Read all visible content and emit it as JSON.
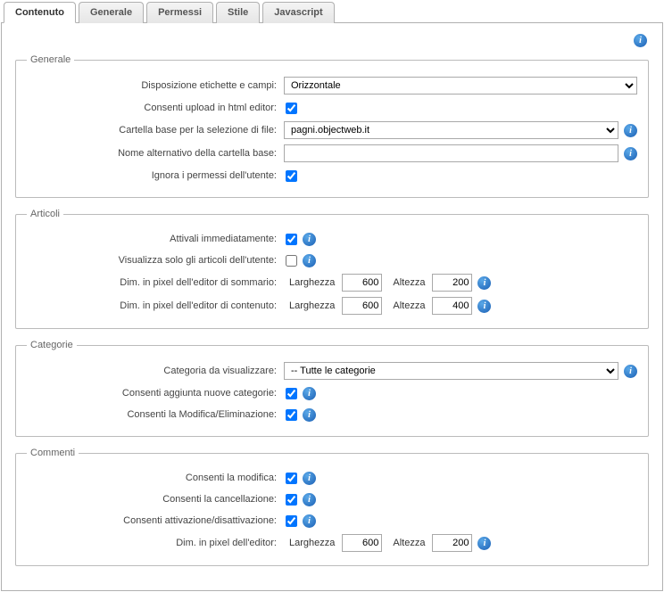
{
  "tabs": {
    "contenuto": "Contenuto",
    "generale": "Generale",
    "permessi": "Permessi",
    "stile": "Stile",
    "javascript": "Javascript"
  },
  "info_icon_glyph": "i",
  "fs_generale": {
    "legend": "Generale",
    "disposizione_label": "Disposizione etichette e campi:",
    "disposizione_value": "Orizzontale",
    "consenti_upload_label": "Consenti upload in html editor:",
    "consenti_upload_checked": true,
    "cartella_base_label": "Cartella base per la selezione di file:",
    "cartella_base_value": "pagni.objectweb.it",
    "nome_alternativo_label": "Nome alternativo della cartella base:",
    "nome_alternativo_value": "",
    "ignora_permessi_label": "Ignora i permessi dell'utente:",
    "ignora_permessi_checked": true
  },
  "fs_articoli": {
    "legend": "Articoli",
    "attivali_label": "Attivali immediatamente:",
    "attivali_checked": true,
    "visualizza_solo_label": "Visualizza solo gli articoli dell'utente:",
    "visualizza_solo_checked": false,
    "dim_sommario_label": "Dim. in pixel dell'editor di sommario:",
    "dim_contenuto_label": "Dim. in pixel dell'editor di contenuto:",
    "larghezza_word": "Larghezza",
    "altezza_word": "Altezza",
    "sommario_w": "600",
    "sommario_h": "200",
    "contenuto_w": "600",
    "contenuto_h": "400"
  },
  "fs_categorie": {
    "legend": "Categorie",
    "categoria_visualizzare_label": "Categoria da visualizzare:",
    "categoria_visualizzare_value": "-- Tutte le categorie",
    "consenti_aggiunta_label": "Consenti aggiunta nuove categorie:",
    "consenti_aggiunta_checked": true,
    "consenti_modelim_label": "Consenti la Modifica/Eliminazione:",
    "consenti_modelim_checked": true
  },
  "fs_commenti": {
    "legend": "Commenti",
    "consenti_modifica_label": "Consenti la modifica:",
    "consenti_modifica_checked": true,
    "consenti_cancellazione_label": "Consenti la cancellazione:",
    "consenti_cancellazione_checked": true,
    "consenti_attdis_label": "Consenti attivazione/disattivazione:",
    "consenti_attdis_checked": true,
    "dim_editor_label": "Dim. in pixel dell'editor:",
    "larghezza_word": "Larghezza",
    "altezza_word": "Altezza",
    "editor_w": "600",
    "editor_h": "200"
  }
}
